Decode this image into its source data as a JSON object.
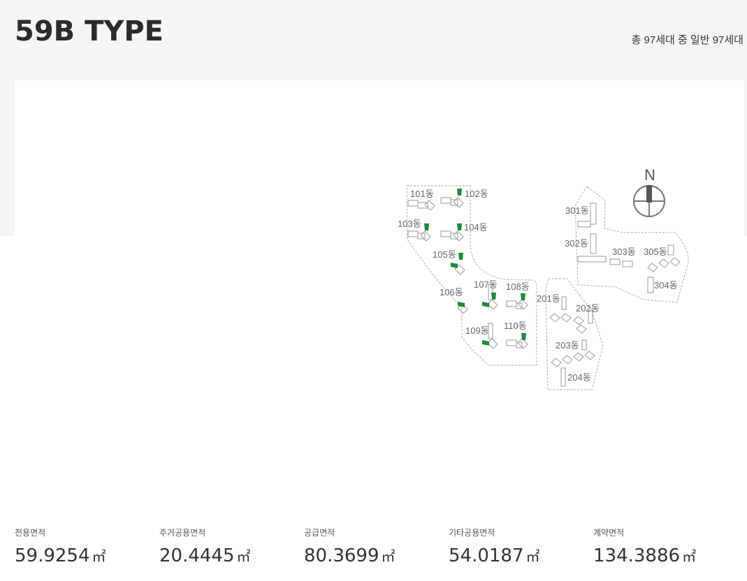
{
  "header": {
    "title": "59B TYPE",
    "summary": "총 97세대 중 일반 97세대"
  },
  "site_map": {
    "north_label": "N",
    "highlight_color": "#1a8c3a",
    "buildings": [
      {
        "label": "101동",
        "highlighted": false
      },
      {
        "label": "102동",
        "highlighted": true
      },
      {
        "label": "103동",
        "highlighted": true
      },
      {
        "label": "104동",
        "highlighted": true
      },
      {
        "label": "105동",
        "highlighted": true
      },
      {
        "label": "106동",
        "highlighted": true
      },
      {
        "label": "107동",
        "highlighted": true
      },
      {
        "label": "108동",
        "highlighted": true
      },
      {
        "label": "109동",
        "highlighted": true
      },
      {
        "label": "110동",
        "highlighted": true
      },
      {
        "label": "201동",
        "highlighted": false
      },
      {
        "label": "202동",
        "highlighted": false
      },
      {
        "label": "203동",
        "highlighted": false
      },
      {
        "label": "204동",
        "highlighted": false
      },
      {
        "label": "301동",
        "highlighted": false
      },
      {
        "label": "302동",
        "highlighted": false
      },
      {
        "label": "303동",
        "highlighted": false
      },
      {
        "label": "304동",
        "highlighted": false
      },
      {
        "label": "305동",
        "highlighted": false
      }
    ]
  },
  "areas": [
    {
      "label": "전용면적",
      "value": "59.9254",
      "unit": "㎡"
    },
    {
      "label": "주거공용면적",
      "value": "20.4445",
      "unit": "㎡"
    },
    {
      "label": "공급면적",
      "value": "80.3699",
      "unit": "㎡"
    },
    {
      "label": "기타공용면적",
      "value": "54.0187",
      "unit": "㎡"
    },
    {
      "label": "계약면적",
      "value": "134.3886",
      "unit": "㎡"
    }
  ]
}
